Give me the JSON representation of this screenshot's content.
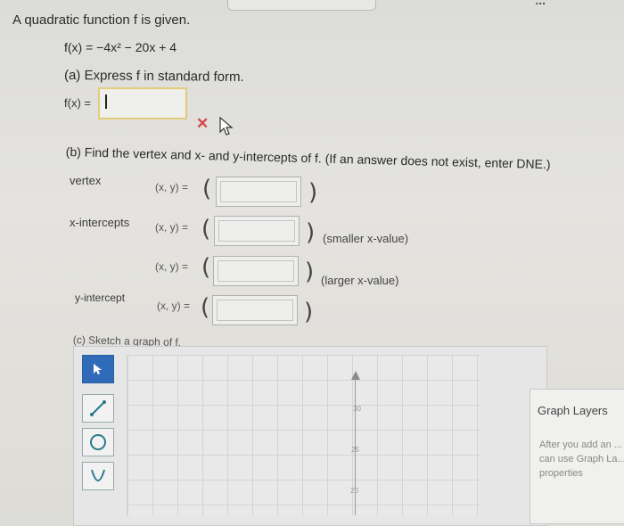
{
  "header": {
    "top_fragment": "..."
  },
  "problem": {
    "intro": "A quadratic function f is given.",
    "function": "f(x) = −4x² − 20x + 4"
  },
  "part_a": {
    "prompt": "(a) Express f in standard form.",
    "label": "f(x) =",
    "input_value": "",
    "status_icon": "x-mark-icon",
    "status_color": "#d4464a"
  },
  "part_b": {
    "prompt": "(b) Find the vertex and x- and y-intercepts of f. (If an answer does not exist, enter DNE.)",
    "xy_label": "(x, y) =",
    "open_paren": "(",
    "close_paren": ")",
    "rows": [
      {
        "label": "vertex",
        "value": "",
        "note": ""
      },
      {
        "label": "x-intercepts",
        "value": "",
        "note": "(smaller x-value)"
      },
      {
        "label": "",
        "value": "",
        "note": "(larger x-value)"
      },
      {
        "label": "y-intercept",
        "value": "",
        "note": ""
      }
    ]
  },
  "part_c": {
    "prompt": "(c) Sketch a graph of f.",
    "tools": [
      "pointer-icon",
      "line-icon",
      "circle-icon",
      "parabola-icon"
    ],
    "selected_tool_color": "#2f6bb8",
    "y_ticks": [
      "30",
      "25",
      "20"
    ],
    "layers": {
      "title": "Graph Layers",
      "description": "After you add an ... can use Graph La... properties"
    }
  }
}
